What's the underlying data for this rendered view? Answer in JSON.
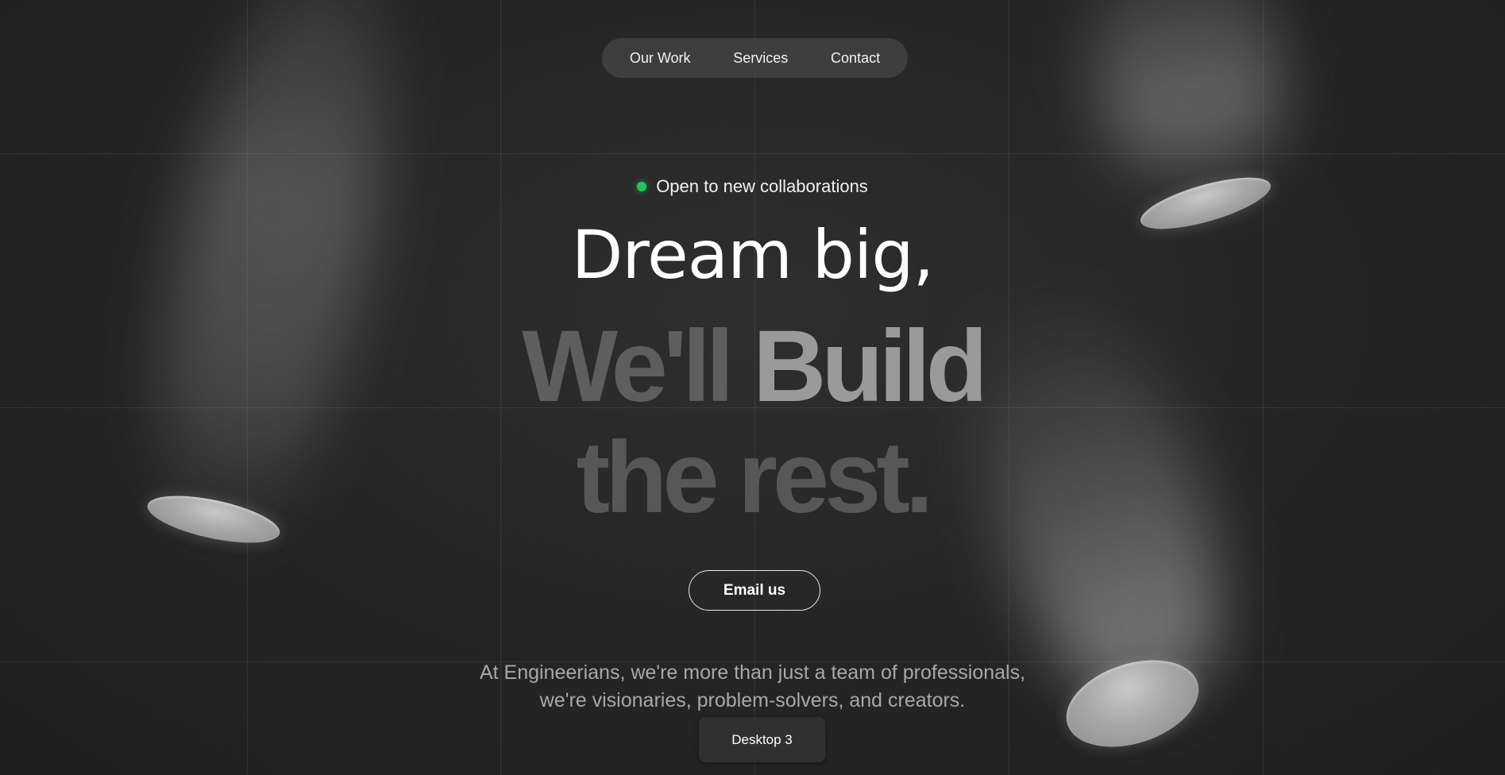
{
  "nav": {
    "items": [
      "Our Work",
      "Services",
      "Contact"
    ]
  },
  "status": {
    "text": "Open to new collaborations",
    "dot_color": "#22c55e"
  },
  "hero": {
    "line1": "Dream big,",
    "line2_dim": "We'll",
    "line2_bright": "Build",
    "line3": "the rest."
  },
  "cta": {
    "label": "Email us"
  },
  "description": {
    "line1": "At Engineerians, we're more than just a team of professionals,",
    "line2": "we're visionaries, problem-solvers, and creators."
  },
  "footer_pill": {
    "label": "Desktop 3"
  }
}
